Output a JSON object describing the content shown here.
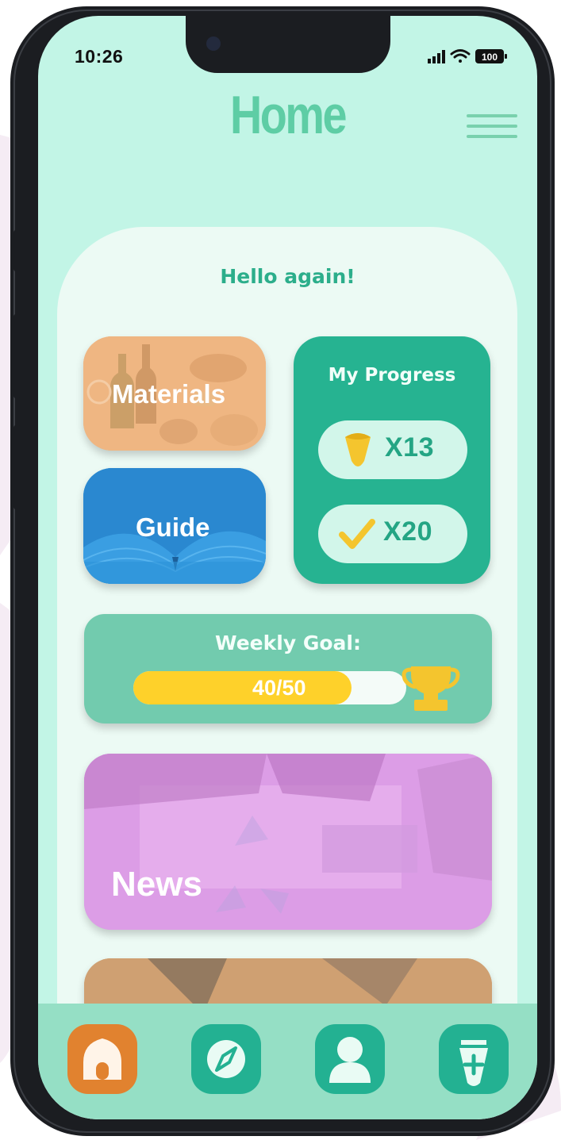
{
  "status_bar": {
    "time": "10:26",
    "battery": "100"
  },
  "header": {
    "title": "Home"
  },
  "main": {
    "greeting": "Hello again!",
    "cards": {
      "materials_label": "Materials",
      "guide_label": "Guide",
      "news_label": "News"
    },
    "progress": {
      "title": "My Progress",
      "items": [
        {
          "icon": "cone-icon",
          "count": "X13"
        },
        {
          "icon": "checkmark-icon",
          "count": "X20"
        }
      ]
    },
    "weekly_goal": {
      "title": "Weekly Goal:",
      "text": "40/50",
      "current": 40,
      "target": 50
    }
  },
  "tab_bar": {
    "items": [
      {
        "name": "home",
        "icon": "house-icon",
        "active": true
      },
      {
        "name": "explore",
        "icon": "compass-icon",
        "active": false
      },
      {
        "name": "profile",
        "icon": "user-icon",
        "active": false
      },
      {
        "name": "bin",
        "icon": "trash-bin-icon",
        "active": false
      }
    ]
  },
  "colors": {
    "screen_bg": "#c2f5e6",
    "accent_green": "#26b391",
    "title_green": "#5ecda5",
    "active_tab": "#e1822f",
    "goal_fill": "#fed12a"
  }
}
